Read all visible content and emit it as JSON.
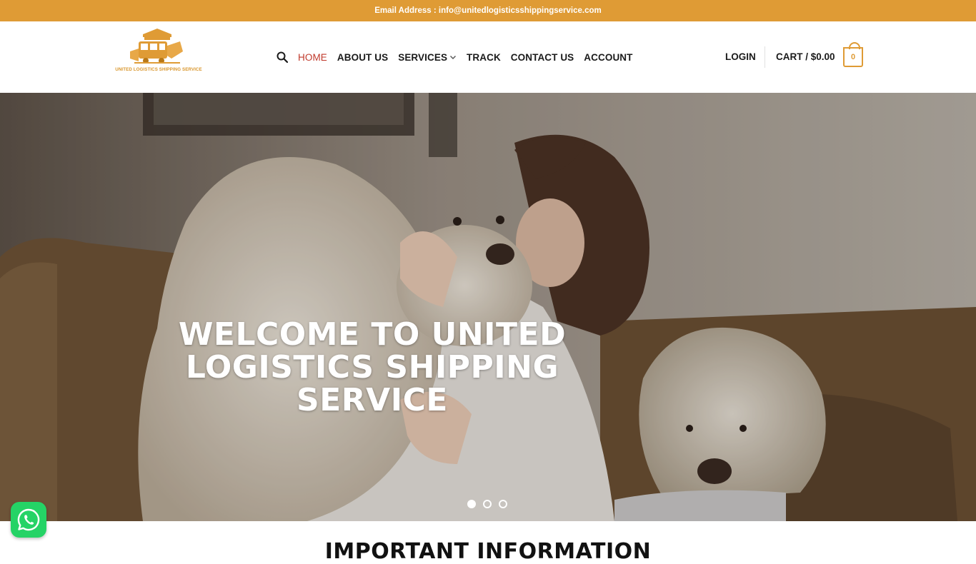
{
  "topbar": {
    "email_text": "Email Address : info@unitedlogisticsshippingservice.com"
  },
  "logo": {
    "text": "UNITED LOGISTICS SHIPPING SERVICE"
  },
  "nav": {
    "items": [
      {
        "label": "HOME",
        "active": true
      },
      {
        "label": "ABOUT US"
      },
      {
        "label": "SERVICES"
      },
      {
        "label": "TRACK"
      },
      {
        "label": "CONTACT US"
      },
      {
        "label": "ACCOUNT"
      }
    ]
  },
  "header": {
    "login_label": "LOGIN",
    "cart_label": "CART / $0.00",
    "cart_count": "0"
  },
  "hero": {
    "title_line1": "WELCOME TO UNITED",
    "title_line2": "LOGISTICS SHIPPING SERVICE",
    "slides": 3,
    "active_slide": 1
  },
  "section": {
    "title": "IMPORTANT INFORMATION"
  },
  "colors": {
    "accent": "#df9b35",
    "active_nav": "#c0392b",
    "whatsapp": "#25d366"
  },
  "icons": {
    "search": "search-icon",
    "chevron": "chevron-down-icon",
    "whatsapp": "whatsapp-icon"
  }
}
